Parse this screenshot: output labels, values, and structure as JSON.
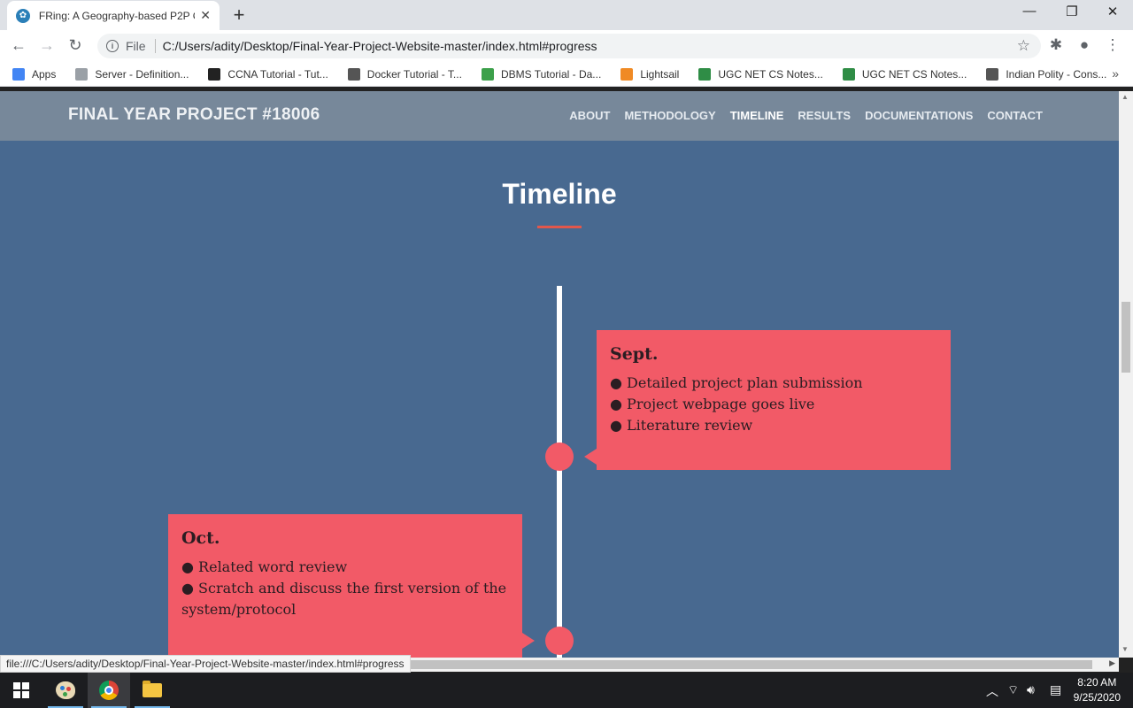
{
  "browser": {
    "tab_title": "FRing: A Geography-based P2P C",
    "tab_favicon": "site-favicon",
    "new_tab": "+",
    "omnibox": {
      "scheme": "File",
      "url": "C:/Users/adity/Desktop/Final-Year-Project-Website-master/index.html#progress"
    },
    "bookmarks": [
      {
        "label": "Apps",
        "icon": "apps-grid-icon",
        "color": "#4285f4"
      },
      {
        "label": "Server - Definition...",
        "icon": "page-icon",
        "color": "#9aa0a6"
      },
      {
        "label": "CCNA Tutorial - Tut...",
        "icon": "tutorial-icon",
        "color": "#222222"
      },
      {
        "label": "Docker Tutorial - T...",
        "icon": "diamond-icon",
        "color": "#555555"
      },
      {
        "label": "DBMS Tutorial - Da...",
        "icon": "b-badge-icon",
        "color": "#3ca04a"
      },
      {
        "label": "Lightsail",
        "icon": "cube-icon",
        "color": "#f08a24"
      },
      {
        "label": "UGC NET CS Notes...",
        "icon": "gfg-icon",
        "color": "#2f8d46"
      },
      {
        "label": "UGC NET CS Notes...",
        "icon": "gfg-icon",
        "color": "#2f8d46"
      },
      {
        "label": "Indian Polity - Cons...",
        "icon": "diamond-icon",
        "color": "#555555"
      }
    ],
    "status_url": "file:///C:/Users/adity/Desktop/Final-Year-Project-Website-master/index.html#progress"
  },
  "site": {
    "brand": "FINAL YEAR PROJECT #18006",
    "menu": [
      {
        "label": "ABOUT",
        "active": false
      },
      {
        "label": "METHODOLOGY",
        "active": false
      },
      {
        "label": "TIMELINE",
        "active": true
      },
      {
        "label": "RESULTS",
        "active": false
      },
      {
        "label": "DOCUMENTATIONS",
        "active": false
      },
      {
        "label": "CONTACT",
        "active": false
      }
    ],
    "section_title": "Timeline",
    "accent_color": "#e2574c",
    "card_color": "#f25a67",
    "background_color": "#486990"
  },
  "timeline": [
    {
      "month": "Sept.",
      "side": "right",
      "items": [
        "● Detailed project plan submission",
        "● Project webpage goes live",
        "● Literature review"
      ]
    },
    {
      "month": "Oct.",
      "side": "left",
      "items": [
        "● Related word review",
        "● Scratch and discuss the first version of the",
        "system/protocol"
      ]
    }
  ],
  "taskbar": {
    "apps": [
      "windows-start-icon",
      "paint-icon",
      "chrome-icon",
      "file-explorer-icon"
    ],
    "time": "8:20 AM",
    "date": "9/25/2020"
  }
}
